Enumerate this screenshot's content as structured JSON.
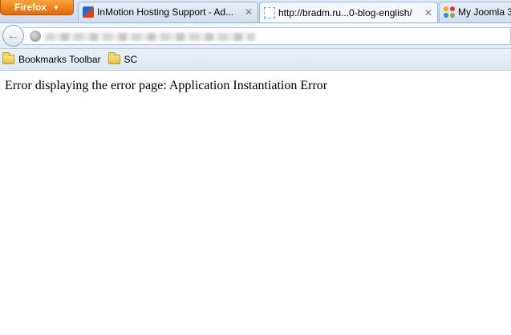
{
  "browser": {
    "app_button_label": "Firefox",
    "tabs": [
      {
        "title": "InMotion Hosting Support - Ad...",
        "favicon": "inmotion-icon",
        "active": false
      },
      {
        "title": "http://bradm.ru...0-blog-english/",
        "favicon": "blank-page-icon",
        "active": true
      },
      {
        "title": "My Joomla 3",
        "favicon": "joomla-icon",
        "active": false
      }
    ],
    "close_glyph": "✕"
  },
  "bookmarks": [
    {
      "label": "Bookmarks Toolbar",
      "icon": "folder-icon"
    },
    {
      "label": "SC",
      "icon": "folder-icon"
    }
  ],
  "page": {
    "message": "Error displaying the error page: Application Instantiation Error"
  },
  "colors": {
    "firefox_orange": "#e06a09",
    "chrome_blue": "#c9d9ee"
  }
}
